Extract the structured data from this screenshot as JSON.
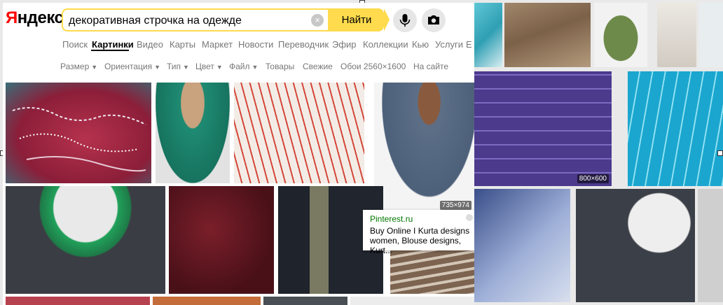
{
  "logo": {
    "first": "Я",
    "rest": "ндекс"
  },
  "search": {
    "value": "декоративная строчка на одежде",
    "clear": "×",
    "button": "Найти"
  },
  "icons": {
    "mic": "microphone-icon",
    "camera": "camera-icon",
    "bookmark": "bookmark-icon"
  },
  "nav": {
    "items": [
      "Поиск",
      "Картинки",
      "Видео",
      "Карты",
      "Маркет",
      "Новости",
      "Переводчик",
      "Эфир",
      "Коллекции",
      "Кью",
      "Услуги",
      "Е"
    ],
    "active": "Картинки"
  },
  "filters": {
    "items": [
      "Размер",
      "Ориентация",
      "Тип",
      "Цвет",
      "Файл",
      "Товары",
      "Свежие",
      "Обои 2560×1600",
      "На сайте"
    ],
    "dropdowns": [
      true,
      true,
      true,
      true,
      true,
      false,
      false,
      false,
      false
    ]
  },
  "back_badge": {
    "size": "800×600"
  },
  "front_badge": {
    "size": "735×974"
  },
  "tooltip": {
    "source": "Pinterest.ru",
    "title": "Buy Online I Kurta designs women, Blouse designs, Kurt..."
  },
  "colors": {
    "accent": "#ffdb4d",
    "logo_red": "#ff0000",
    "source_green": "#007700"
  }
}
